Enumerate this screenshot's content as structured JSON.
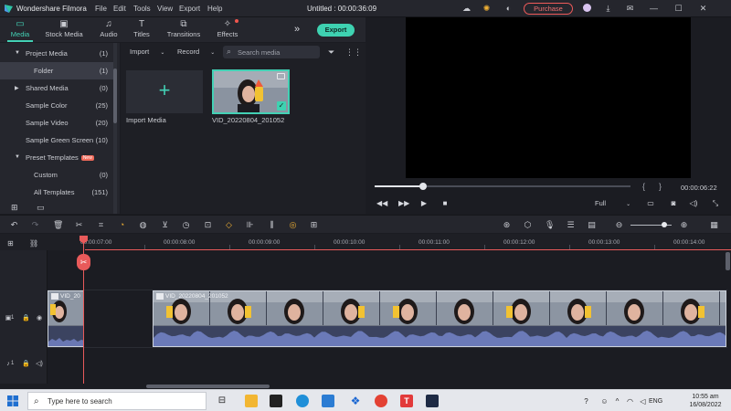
{
  "app": {
    "name": "Wondershare Filmora",
    "document_title": "Untitled : 00:00:36:09"
  },
  "menu": [
    "File",
    "Edit",
    "Tools",
    "View",
    "Export",
    "Help"
  ],
  "titlebar": {
    "purchase_label": "Purchase"
  },
  "tabs": [
    {
      "label": "Media",
      "icon": "folder-icon",
      "active": true
    },
    {
      "label": "Stock Media",
      "icon": "stock-media-icon",
      "active": false
    },
    {
      "label": "Audio",
      "icon": "music-note-icon",
      "active": false
    },
    {
      "label": "Titles",
      "icon": "text-t-icon",
      "active": false
    },
    {
      "label": "Transitions",
      "icon": "transitions-icon",
      "active": false
    },
    {
      "label": "Effects",
      "icon": "effects-icon",
      "active": false
    }
  ],
  "export_label": "Export",
  "sidebar": {
    "items": [
      {
        "label": "Project Media",
        "count": "(1)",
        "expanded": true
      },
      {
        "label": "Folder",
        "count": "(1)",
        "selected": true
      },
      {
        "label": "Shared Media",
        "count": "(0)"
      },
      {
        "label": "Sample Color",
        "count": "(25)"
      },
      {
        "label": "Sample Video",
        "count": "(20)"
      },
      {
        "label": "Sample Green Screen",
        "count": "(10)"
      },
      {
        "label": "Preset Templates",
        "badge": "New"
      },
      {
        "label": "Custom",
        "count": "(0)"
      },
      {
        "label": "All Templates",
        "count": "(151)"
      }
    ]
  },
  "media": {
    "import_dropdown": "Import",
    "record_dropdown": "Record",
    "search_placeholder": "Search media",
    "import_label": "Import Media",
    "clip_label": "VID_20220804_201052"
  },
  "preview": {
    "time": "00:00:06:22",
    "progress": 0.19,
    "quality": "Full"
  },
  "ruler": {
    "labels": [
      "00:00:07:00",
      "00:00:08:00",
      "00:00:09:00",
      "00:00:10:00",
      "00:00:11:00",
      "00:00:12:00",
      "00:00:13:00",
      "00:00:14:00"
    ]
  },
  "tracks": {
    "video_track_label": "1",
    "audio_track_label": "1",
    "clip_a_name": "VID_20",
    "clip_b_name": "VID_20220804_201052"
  },
  "taskbar": {
    "search_placeholder": "Type here to search",
    "language": "ENG",
    "time": "10:55 am",
    "date": "16/08/2022"
  },
  "colors": {
    "accent": "#3ed2b1",
    "playhead": "#e85a5a",
    "purchase": "#ef5a5a"
  }
}
